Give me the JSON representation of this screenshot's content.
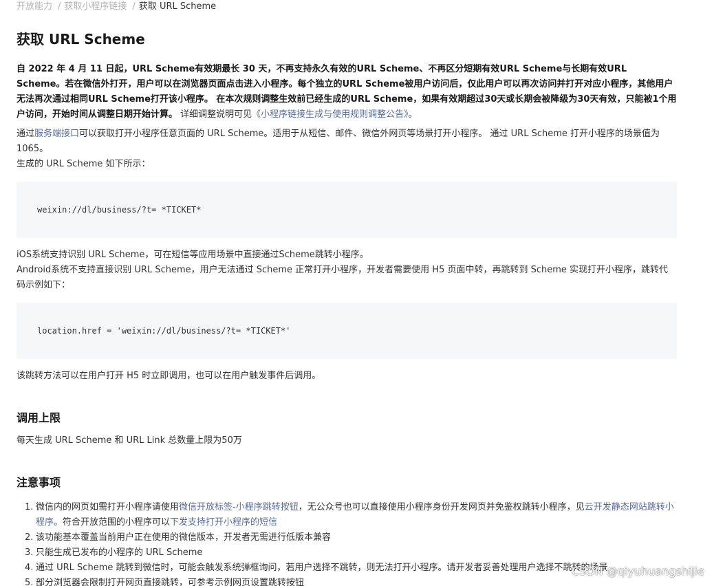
{
  "breadcrumb": {
    "items": [
      "开放能力",
      "获取小程序链接"
    ],
    "separator": "/",
    "current": "获取 URL Scheme"
  },
  "title": "获取 URL Scheme",
  "notice": {
    "bold_text": "自 2022 年 4 月 11 日起，URL Scheme有效期最长 30 天，不再支持永久有效的URL Scheme、不再区分短期有效URL Scheme与长期有效URL Scheme。若在微信外打开，用户可以在浏览器页面点击进入小程序。每个独立的URL Scheme被用户访问后，仅此用户可以再次访问并打开对应小程序，其他用户无法再次通过相同URL Scheme打开该小程序。 在本次规则调整生效前已经生成的URL Scheme，如果有效期超过30天或长期会被降级为30天有效，只能被1个用户访问，开始时间从调整日期开始计算。",
    "tail_text": " 详细调整说明可见",
    "link_text": "《小程序链接生成与使用规则调整公告》",
    "end_text": "。"
  },
  "intro": {
    "prefix": "通过",
    "link": "服务端接口",
    "suffix": "可以获取打开小程序任意页面的 URL Scheme。适用于从短信、邮件、微信外网页等场景打开小程序。 通过 URL Scheme 打开小程序的场景值为 1065。",
    "line2": "生成的 URL Scheme 如下所示："
  },
  "code1": "weixin://dl/business/?t= *TICKET*",
  "ios_text": "iOS系统支持识别 URL Scheme，可在短信等应用场景中直接通过Scheme跳转小程序。",
  "android_text": "Android系统不支持直接识别 URL Scheme，用户无法通过 Scheme 正常打开小程序，开发者需要使用 H5 页面中转，再跳转到 Scheme 实现打开小程序，跳转代码示例如下：",
  "code2": "location.href = 'weixin://dl/business/?t= *TICKET*'",
  "after_code_text": "该跳转方法可以在用户打开 H5 时立即调用，也可以在用户触发事件后调用。",
  "limit_section": {
    "title": "调用上限",
    "text": "每天生成 URL Scheme 和 URL Link 总数量上限为50万"
  },
  "notes_section": {
    "title": "注意事项",
    "items": [
      {
        "num": "1.",
        "parts": [
          {
            "t": "微信内的网页如需打开小程序请使用",
            "link": false
          },
          {
            "t": "微信开放标签-小程序跳转按钮",
            "link": true
          },
          {
            "t": "，无公众号也可以直接使用小程序身份开发网页并免鉴权跳转小程序，见",
            "link": false
          },
          {
            "t": "云开发静态网站跳转小程序",
            "link": true
          },
          {
            "t": "。符合开放范围的小程序可以",
            "link": false
          },
          {
            "t": "下发支持打开小程序的短信",
            "link": true
          }
        ]
      },
      {
        "num": "2.",
        "parts": [
          {
            "t": "该功能基本覆盖当前用户正在使用的微信版本，开发者无需进行低版本兼容",
            "link": false
          }
        ]
      },
      {
        "num": "3.",
        "parts": [
          {
            "t": "只能生成已发布的小程序的 URL Scheme",
            "link": false
          }
        ]
      },
      {
        "num": "4.",
        "parts": [
          {
            "t": "通过 URL Scheme 跳转到微信时，可能会触发系统弹框询问，若用户选择不跳转，则无法打开小程序。请开发者妥善处理用户选择不跳转的场景",
            "link": false
          }
        ]
      },
      {
        "num": "5.",
        "parts": [
          {
            "t": "部分浏览器会限制打开网页直接跳转，可参考示例网页设置跳转按钮",
            "link": false
          }
        ]
      }
    ]
  },
  "watermark": "CSDN @qiyuhuangshijie",
  "colors": {
    "link": "#576b95",
    "code_bg": "#f6f7f8",
    "text": "#333333",
    "breadcrumb_muted": "#b2b2b2"
  }
}
